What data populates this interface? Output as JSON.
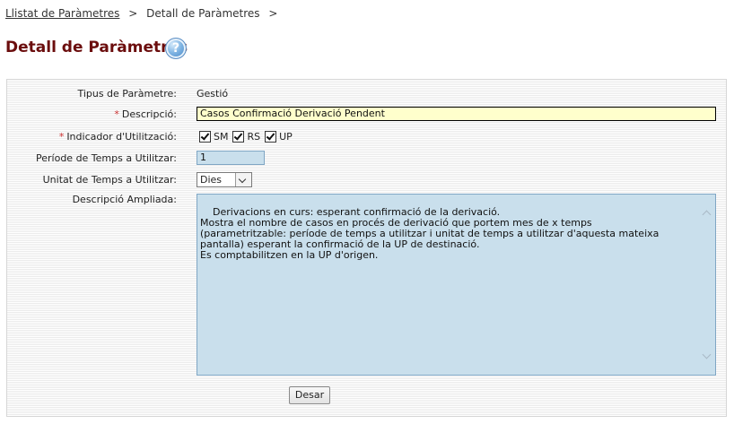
{
  "breadcrumb": {
    "items": [
      {
        "label": "Llistat de Paràmetres",
        "link": true
      },
      {
        "label": "Detall de Paràmetres",
        "link": false
      }
    ],
    "separator": ">"
  },
  "page": {
    "title": "Detall de Paràmetres",
    "help_icon": "help-question-icon",
    "help_glyph": "?"
  },
  "form": {
    "tipus": {
      "label": "Tipus de Paràmetre:",
      "value": "Gestió"
    },
    "descripcio": {
      "required_mark": "*",
      "label": "Descripció:",
      "value": "Casos Confirmació Derivació Pendent"
    },
    "indicador": {
      "required_mark": "*",
      "label": "Indicador d'Utilització:",
      "options": [
        {
          "label": "SM",
          "checked": true
        },
        {
          "label": "RS",
          "checked": true
        },
        {
          "label": "UP",
          "checked": true
        }
      ]
    },
    "periode": {
      "label": "Període de Temps a Utilitzar:",
      "value": "1"
    },
    "unitat": {
      "label": "Unitat de Temps a Utilitzar:",
      "selected": "Dies"
    },
    "ampliada": {
      "label": "Descripció Ampliada:",
      "value": "Derivacions en curs: esperant confirmació de la derivació.\nMostra el nombre de casos en procés de derivació que portem mes de x temps\n(parametritzable: període de temps a utilitzar i unitat de temps a utilitzar d'aquesta mateixa\npantalla) esperant la confirmació de la UP de destinació.\nEs comptabilitzen en la UP d'origen."
    },
    "save_label": "Desar"
  },
  "colors": {
    "title": "#6b0d0d",
    "required_mark": "#cc3333",
    "input_highlight": "#ffffcc",
    "input_readonly": "#c9dfec"
  }
}
